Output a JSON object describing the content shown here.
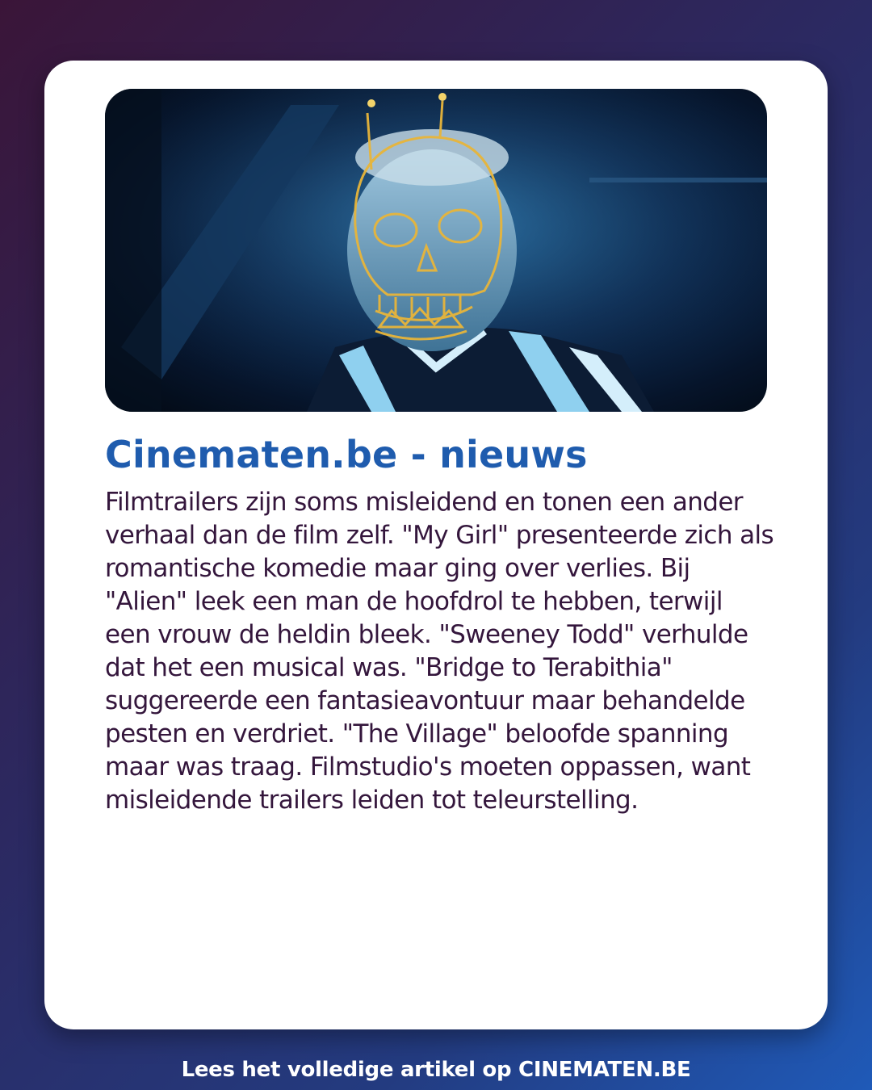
{
  "article": {
    "image_alt": "Man met gouden schedeltekening en kroon in blauw licht",
    "title": "Cinematen.be - nieuws",
    "body": "Filmtrailers zijn soms misleidend en tonen een ander verhaal dan de film zelf. \"My Girl\" presenteerde zich als romantische komedie maar ging over verlies. Bij \"Alien\" leek een man de hoofdrol te hebben, terwijl een vrouw de heldin bleek. \"Sweeney Todd\" verhulde dat het een musical was. \"Bridge to Terabithia\" suggereerde een fantasieavontuur maar behandelde pesten en verdriet. \"The Village\" beloofde spanning maar was traag. Filmstudio's moeten oppassen, want misleidende trailers leiden tot teleurstelling."
  },
  "footer": {
    "cta": "Lees het volledige artikel op CINEMATEN.BE"
  },
  "colors": {
    "title": "#1f5cae",
    "body_text": "#34163c",
    "card": "#ffffff",
    "accent_gold": "#e8b53a"
  }
}
